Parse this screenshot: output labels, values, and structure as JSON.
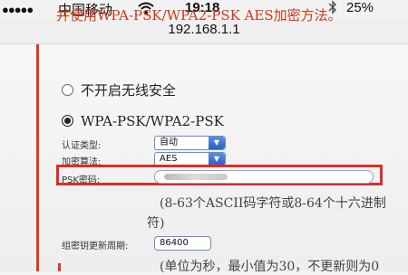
{
  "status_bar": {
    "signal": "●●●●●",
    "carrier": "中国移动",
    "wifi_icon": "wifi-icon",
    "time": "19:18",
    "bluetooth_icon": "bluetooth-icon",
    "battery": "25%"
  },
  "address_bar": {
    "url": "192.168.1.1"
  },
  "page": {
    "notice": "并使用WPA-PSK/WPA2-PSK AES加密方法。",
    "radio_no_security": "不开启无线安全",
    "radio_no_security_checked": false,
    "radio_wpa": "WPA-PSK/WPA2-PSK",
    "radio_wpa_checked": true,
    "auth_type_label": "认证类型:",
    "auth_type_value": "自动",
    "encryption_label": "加密算法:",
    "encryption_value": "AES",
    "psk_label": "PSK密码:",
    "psk_value_obscured": true,
    "psk_hint_line1": "(8-63个ASCII码字符或8-64个十六进制",
    "psk_hint_line2": "符)",
    "group_key_label": "组密钥更新周期:",
    "group_key_value": "86400",
    "group_key_hint": "(单位为秒，最小值为30，不更新则为0"
  },
  "colors": {
    "accent_red": "#d2361a",
    "highlight_red": "#e02a2a",
    "select_blue": "#2b5fc2"
  }
}
